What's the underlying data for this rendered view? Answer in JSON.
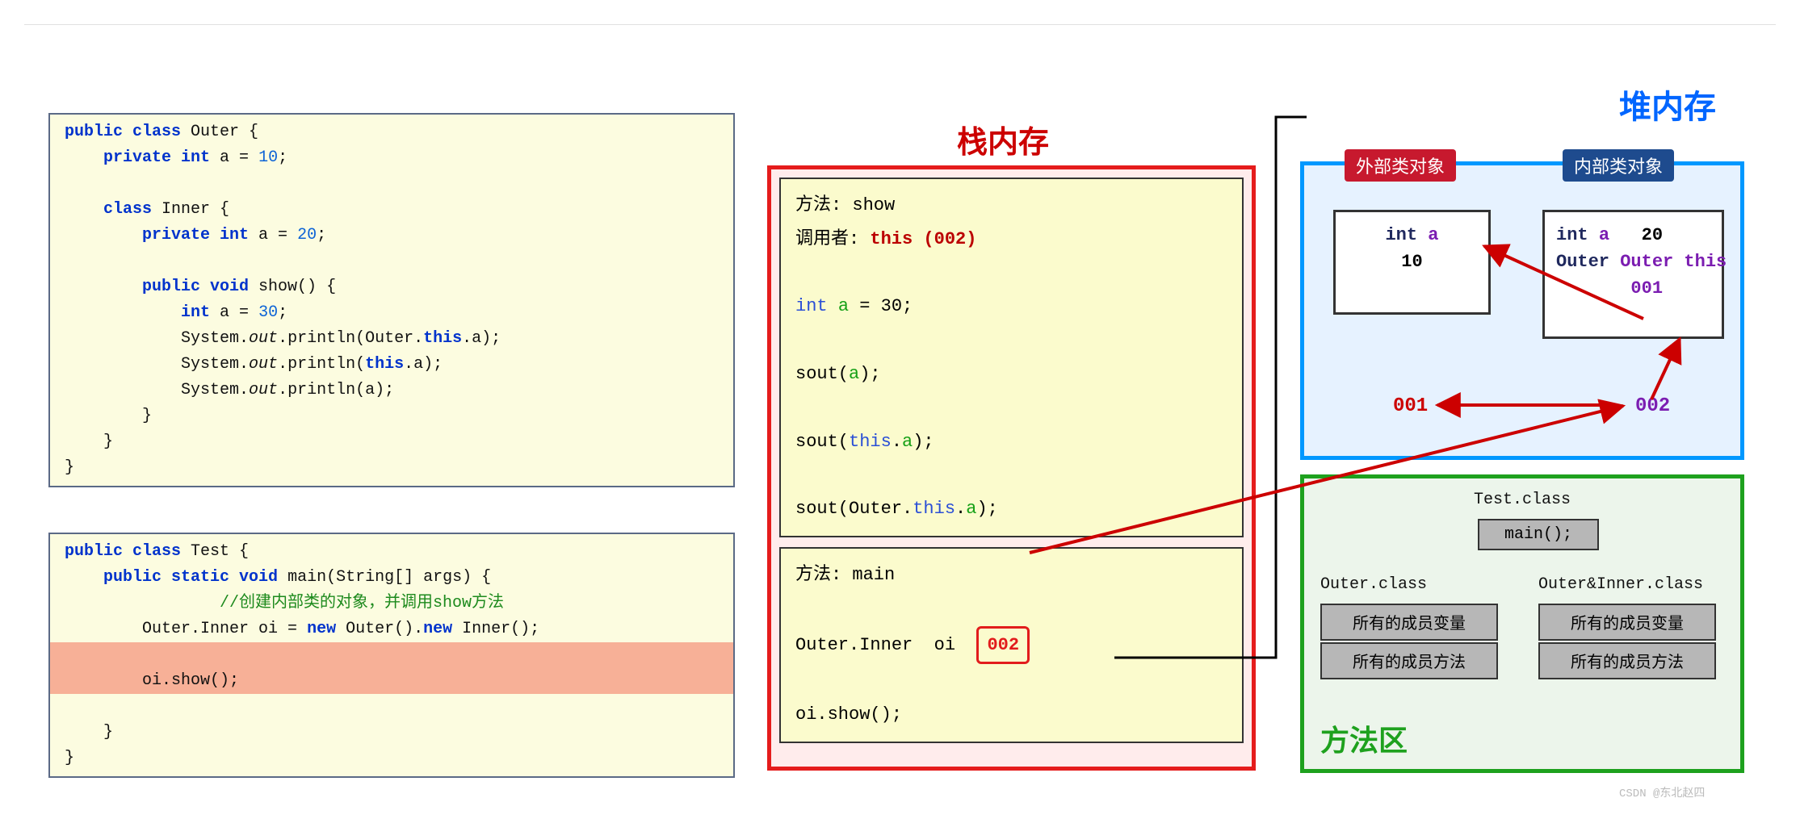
{
  "code_outer": "public class Outer {\n    private int a = 10;\n\n    class Inner {\n        private int a = 20;\n\n        public void show() {\n            int a = 30;\n            System.out.println(Outer.this.a);\n            System.out.println(this.a);\n            System.out.println(a);\n        }\n    }\n}",
  "code_test": {
    "l1": "public class Test {",
    "l2": "    public static void main(String[] args) {",
    "l3": "        //创建内部类的对象，并调用show方法",
    "l4": "        Outer.Inner oi = new Outer().new Inner();",
    "l5": "        oi.show();",
    "l6": "    }",
    "l7": "}"
  },
  "stack": {
    "title": "栈内存",
    "frame_show": {
      "method": "方法: show",
      "caller_label": "调用者:",
      "caller_value": "this (002)",
      "line_decl_pre": "int ",
      "line_decl_var": "a",
      "line_decl_post": " = 30;",
      "sout_a_pre": "sout(",
      "sout_a_var": "a",
      "sout_a_post": ");",
      "sout_this_pre": "sout(",
      "sout_this_kw": "this",
      "sout_this_dot": ".",
      "sout_this_var": "a",
      "sout_this_post": ");",
      "sout_outer": "sout(Outer.",
      "sout_outer_kw": "this",
      "sout_outer_dot": ".",
      "sout_outer_var": "a",
      "sout_outer_post": ");"
    },
    "frame_main": {
      "method": "方法: main",
      "decl": "Outer.Inner  oi ",
      "addr": "002",
      "call": "oi.show();"
    }
  },
  "heap": {
    "title": "堆内存",
    "outer_pill": "外部类对象",
    "inner_pill": "内部类对象",
    "outer_obj": {
      "type": "int",
      "field": "a",
      "value": "10",
      "addr": "001"
    },
    "inner_obj": {
      "type": "int",
      "field": "a",
      "value": "20",
      "ref_label": "Outer this",
      "ref_addr": "001",
      "addr": "002"
    }
  },
  "method_area": {
    "title": "方法区",
    "test_class": "Test.class",
    "test_method": "main();",
    "outer_class": "Outer.class",
    "inner_class": "Outer&Inner.class",
    "members_vars": "所有的成员变量",
    "members_methods": "所有的成员方法"
  },
  "watermark": "CSDN @东北赵四"
}
